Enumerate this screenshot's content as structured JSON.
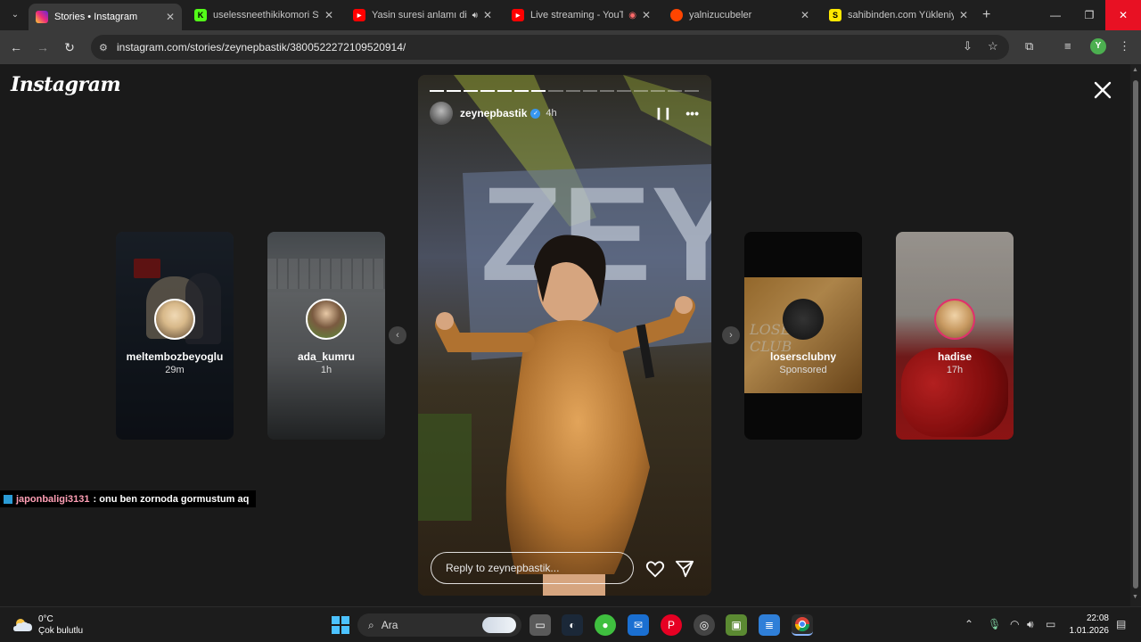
{
  "browser": {
    "tabs": [
      {
        "title": "Stories • Instagram",
        "favicon_color": "#e1306c",
        "active": true
      },
      {
        "title": "uselessneethikikomori Stre",
        "favicon_color": "#53fc18",
        "active": false
      },
      {
        "title": "Yasin suresi anlamı din",
        "favicon_color": "#ff0000",
        "active": false
      },
      {
        "title": "Live streaming - YouTu",
        "favicon_color": "#ff0000",
        "active": false
      },
      {
        "title": "yalnizucubeler",
        "favicon_color": "#ff4500",
        "active": false
      },
      {
        "title": "sahibinden.com Yükleniy",
        "favicon_color": "#ffe800",
        "active": false
      }
    ],
    "url": "instagram.com/stories/zeynepbastik/3800522272109520914/",
    "profile_initial": "Y"
  },
  "page": {
    "logo": "Instagram",
    "story": {
      "username": "zeynepbastik",
      "time": "4h",
      "segments_total": 16,
      "segments_done": 7,
      "reply_placeholder": "Reply to zeynepbastik..."
    },
    "side_stories": [
      {
        "username": "meltembozbeyoglu",
        "time": "29m"
      },
      {
        "username": "ada_kumru",
        "time": "1h"
      },
      {
        "username": "losersclubny",
        "time": "Sponsored"
      },
      {
        "username": "hadise",
        "time": "17h"
      }
    ],
    "chat": {
      "user": "japonbaligi3131",
      "message": ": onu ben zornoda gormustum aq"
    }
  },
  "taskbar": {
    "weather_temp": "0°C",
    "weather_desc": "Çok bulutlu",
    "search_label": "Ara",
    "time": "22:08",
    "date": "1.01.2026"
  }
}
